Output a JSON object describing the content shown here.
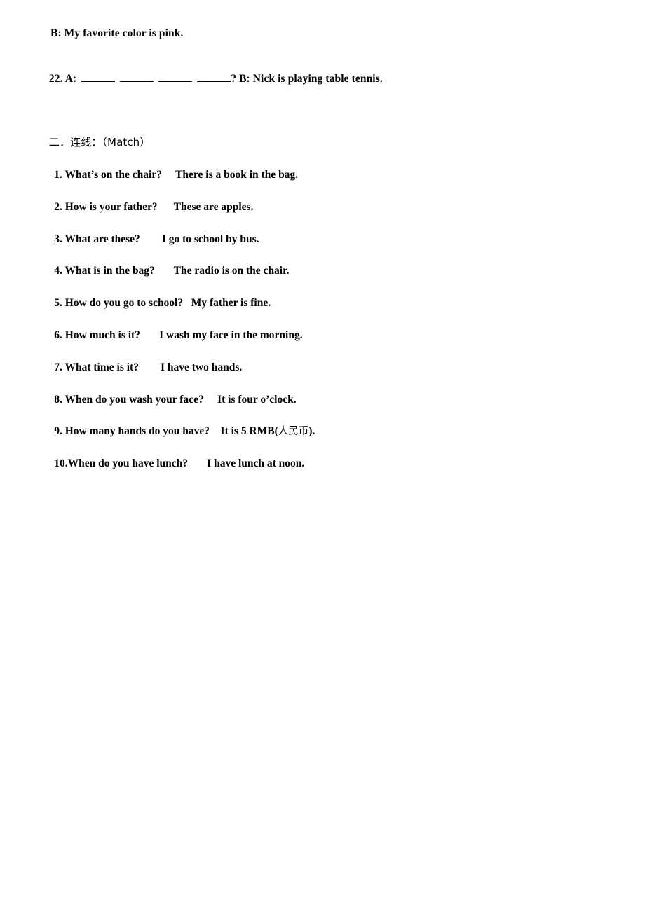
{
  "document": {
    "type": "worksheet-page",
    "background_color": "#ffffff",
    "text_color": "#000000"
  },
  "dialogue": {
    "answer_line": "B: My favorite color is pink.",
    "question_number": "22. A:",
    "blank_count": 4,
    "after_blanks": "? B: Nick is playing table tennis."
  },
  "section": {
    "number": "二．",
    "title_cjk": "连线：",
    "title_paren": "（Match）",
    "full_heading": "二．连线：（Match）"
  },
  "match": {
    "items": [
      {
        "number": "1.",
        "question": " What’s on the chair?",
        "gap": "     ",
        "answer": "There is a book in the bag."
      },
      {
        "number": "2.",
        "question": " How is your father?",
        "gap": "      ",
        "answer": "These are apples."
      },
      {
        "number": "3.",
        "question": " What are these?",
        "gap": "        ",
        "answer": "I go to school by bus."
      },
      {
        "number": "4.",
        "question": " What is in the bag?",
        "gap": "       ",
        "answer": "The radio is on the chair."
      },
      {
        "number": "5.",
        "question": " How do you go to school?",
        "gap": "   ",
        "answer": "My father is fine."
      },
      {
        "number": "6.",
        "question": " How much is it?",
        "gap": "       ",
        "answer": "I wash my face in the morning."
      },
      {
        "number": "7.",
        "question": " What time is it?",
        "gap": "        ",
        "answer": "I have two hands."
      },
      {
        "number": "8.",
        "question": " When do you wash your face?",
        "gap": "     ",
        "answer": "It is four o’clock."
      },
      {
        "number": "9.",
        "question": " How many hands do you have?",
        "gap": "    ",
        "answer": "It is 5 RMB(",
        "answer_cjk": "人民币",
        "answer_tail": ")."
      },
      {
        "number": "10.",
        "question": "When do you have lunch?",
        "gap": "       ",
        "answer": "I have lunch at noon."
      }
    ]
  }
}
